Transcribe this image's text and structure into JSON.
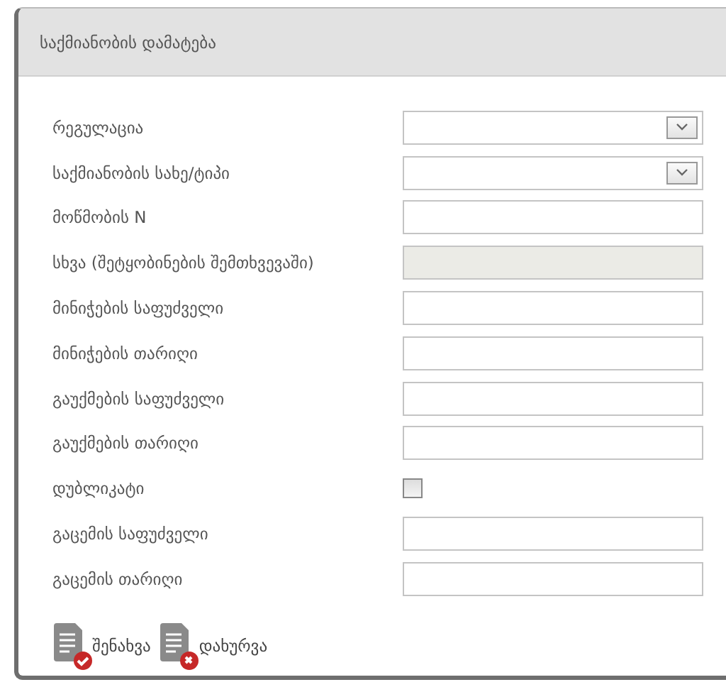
{
  "dialog": {
    "title": "საქმიანობის დამატება"
  },
  "fields": [
    {
      "label": "რეგულაცია",
      "kind": "select",
      "disabled": false
    },
    {
      "label": "საქმიანობის სახე/ტიპი",
      "kind": "select",
      "disabled": false
    },
    {
      "label": "მოწმობის N",
      "kind": "text",
      "disabled": false
    },
    {
      "label": "სხვა (შეტყობინების შემთხვევაში)",
      "kind": "text",
      "disabled": true
    },
    {
      "label": "მინიჭების საფუძველი",
      "kind": "text",
      "disabled": false
    },
    {
      "label": "მინიჭების თარიღი",
      "kind": "text",
      "disabled": false
    },
    {
      "label": "გაუქმების საფუძველი",
      "kind": "text",
      "disabled": false
    },
    {
      "label": "გაუქმების თარიღი",
      "kind": "text",
      "disabled": false
    },
    {
      "label": "დუბლიკატი",
      "kind": "checkbox",
      "checked": false
    },
    {
      "label": "გაცემის საფუძველი",
      "kind": "text",
      "disabled": false
    },
    {
      "label": "გაცემის თარიღი",
      "kind": "text",
      "disabled": false
    }
  ],
  "buttons": [
    {
      "label": "შენახვა",
      "kind": "save"
    },
    {
      "label": "დახურვა",
      "kind": "close"
    }
  ]
}
